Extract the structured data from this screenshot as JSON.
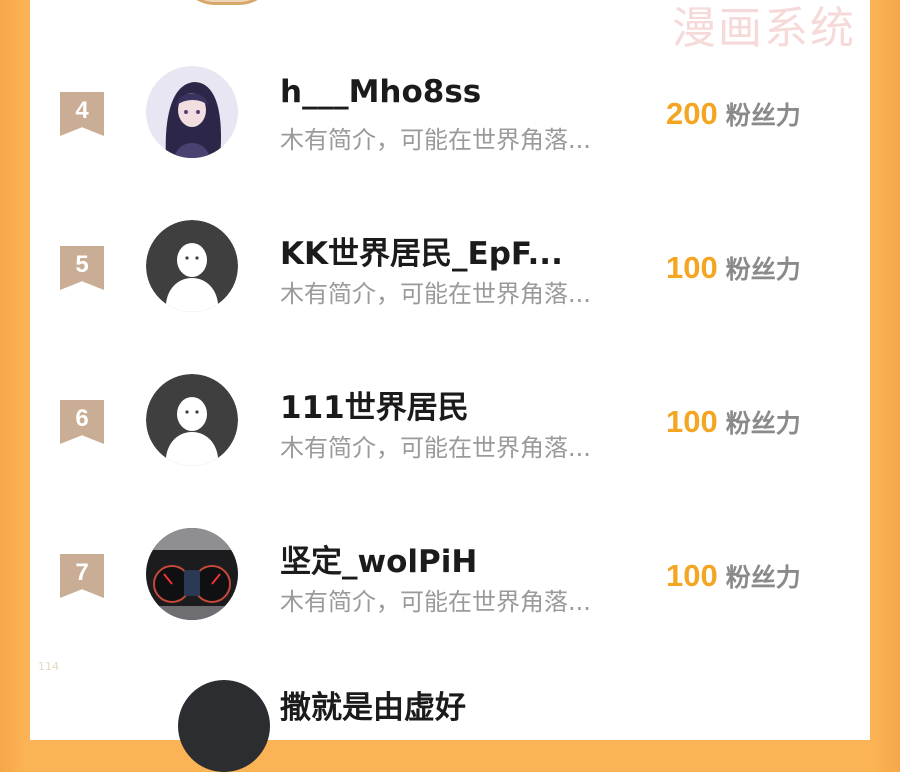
{
  "watermark": "漫画系统",
  "page_number": "114",
  "colors": {
    "accent": "#f4a521",
    "frame": "#fbb455",
    "rank_badge": "#c9ad94"
  },
  "rows": [
    {
      "rank": "4",
      "avatar": "anime-girl-avatar",
      "name": "h___Mho8ss",
      "bio": "木有简介，可能在世界角落...",
      "score": "200",
      "unit": "粉丝力"
    },
    {
      "rank": "5",
      "avatar": "default-person-avatar",
      "name": "KK世界居民_EpF...",
      "bio": "木有简介，可能在世界角落...",
      "score": "100",
      "unit": "粉丝力"
    },
    {
      "rank": "6",
      "avatar": "default-person-avatar",
      "name": "111世界居民",
      "bio": "木有简介，可能在世界角落...",
      "score": "100",
      "unit": "粉丝力"
    },
    {
      "rank": "7",
      "avatar": "car-dashboard-avatar",
      "name": "坚定_wolPiH",
      "bio": "木有简介，可能在世界角落...",
      "score": "100",
      "unit": "粉丝力"
    }
  ],
  "next_row_name_partial": "撒就是由虚好"
}
